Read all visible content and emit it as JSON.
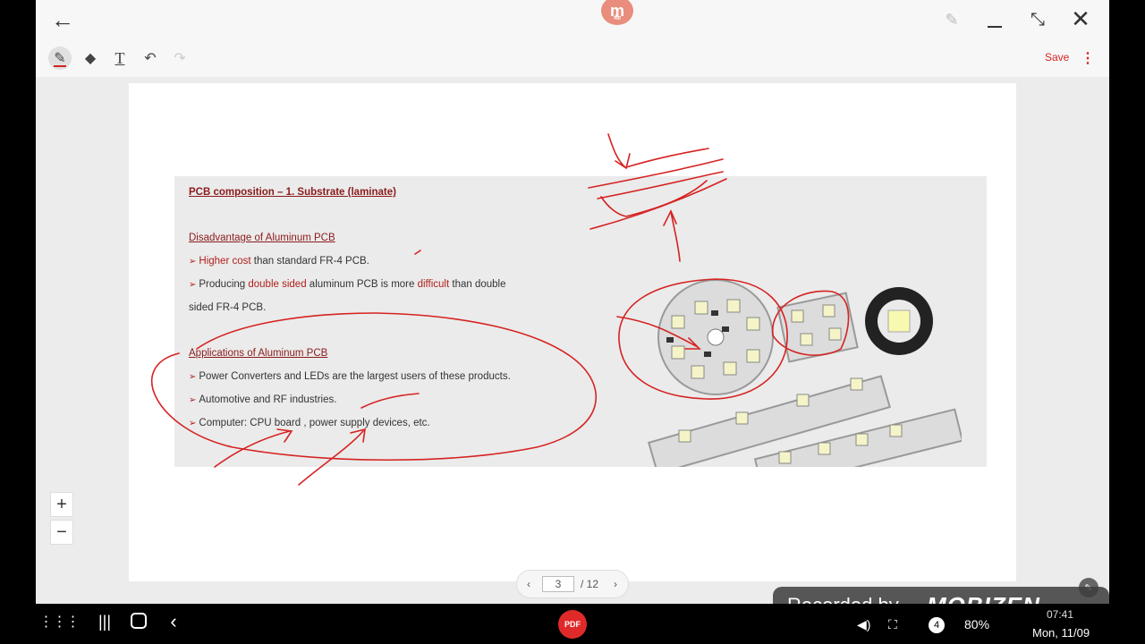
{
  "window": {
    "back_icon": "arrow-left-icon",
    "logo_letter": "m",
    "logo_sub": "मेरा",
    "pin_icon": "pin-icon",
    "minimize_icon": "minimize-icon",
    "restore_icon": "restore-icon",
    "close_icon": "close-icon"
  },
  "toolbar": {
    "pen_icon": "pen-icon",
    "eraser_icon": "eraser-icon",
    "text_icon": "text-icon",
    "undo_icon": "undo-icon",
    "redo_icon": "redo-icon",
    "save_label": "Save",
    "more_icon": "more-vertical-icon",
    "accent": "#d62222"
  },
  "slide": {
    "title": "PCB composition – 1. Substrate (laminate)",
    "disadvantage_heading": "Disadvantage of Aluminum PCB",
    "d1_red": "Higher cost",
    "d1_rest": " than standard FR-4 PCB.",
    "d2_a": "Producing ",
    "d2_red1": "double sided",
    "d2_b": " aluminum  PCB is more ",
    "d2_red2": "difficult",
    "d2_c": " than double",
    "d2_line2": "sided FR-4 PCB.",
    "applications_heading": "Applications of Aluminum PCB",
    "a1": "Power Converters and LEDs are the largest users of these products.",
    "a2": "Automotive and RF industries.",
    "a3": "Computer: CPU board , power supply devices, etc.",
    "bullet": "➢"
  },
  "zoom": {
    "in_label": "+",
    "out_label": "−"
  },
  "pagination": {
    "prev_icon": "‹",
    "current": "3",
    "total": "/ 12",
    "next_icon": "›"
  },
  "watermark": {
    "text": "Recorded by",
    "brand": "MOBIZEN"
  },
  "system": {
    "pdf_label": "PDF",
    "status_time": "07:41",
    "battery": "80%",
    "date": "Mon, 11/09"
  }
}
